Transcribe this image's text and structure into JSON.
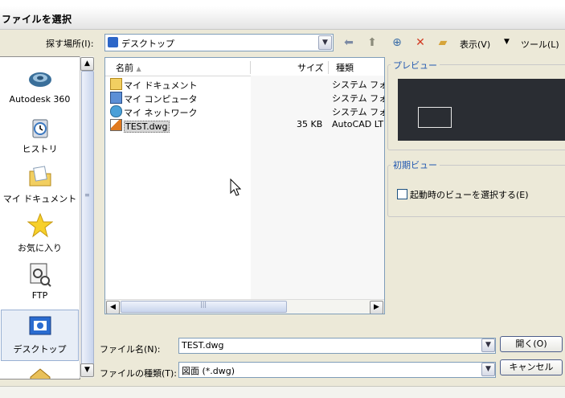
{
  "window": {
    "title": "ファイルを選択"
  },
  "toolbar": {
    "lookin_label": "探す場所(I):",
    "lookin_value": "デスクトップ",
    "view_label": "表示(V)",
    "tools_label": "ツール(L)",
    "icons": [
      "back-arrow-icon",
      "folder-up-icon",
      "search-web-icon",
      "delete-x-icon",
      "new-folder-icon",
      "dropdown-arrow-icon"
    ]
  },
  "places": [
    {
      "label": "Autodesk 360",
      "icon": "autodesk-cloud-icon"
    },
    {
      "label": "ヒストリ",
      "icon": "history-clock-icon"
    },
    {
      "label": "マイ ドキュメント",
      "icon": "my-documents-icon"
    },
    {
      "label": "お気に入り",
      "icon": "favorites-star-icon"
    },
    {
      "label": "FTP",
      "icon": "ftp-icon"
    },
    {
      "label": "デスクトップ",
      "icon": "desktop-icon"
    }
  ],
  "filelist": {
    "columns": {
      "name": "名前",
      "size": "サイズ",
      "type": "種類"
    },
    "rows": [
      {
        "name": "マイ ドキュメント",
        "size": "",
        "type": "システム フォ/",
        "icon": "folder-docs-icon"
      },
      {
        "name": "マイ コンピュータ",
        "size": "",
        "type": "システム フォ/",
        "icon": "computer-icon"
      },
      {
        "name": "マイ ネットワーク",
        "size": "",
        "type": "システム フォ/",
        "icon": "network-icon"
      },
      {
        "name": "TEST.dwg",
        "size": "35 KB",
        "type": "AutoCAD LT",
        "icon": "dwg-file-icon",
        "selected": true
      }
    ]
  },
  "preview": {
    "title": "プレビュー"
  },
  "initial_view": {
    "title": "初期ビュー",
    "checkbox_label": "起動時のビューを選択する(E)",
    "checked": false
  },
  "filename": {
    "label": "ファイル名(N):",
    "value": "TEST.dwg"
  },
  "filetype": {
    "label": "ファイルの種類(T):",
    "value": "図面 (*.dwg)"
  },
  "buttons": {
    "open": "開く(O)",
    "cancel": "キャンセル"
  }
}
